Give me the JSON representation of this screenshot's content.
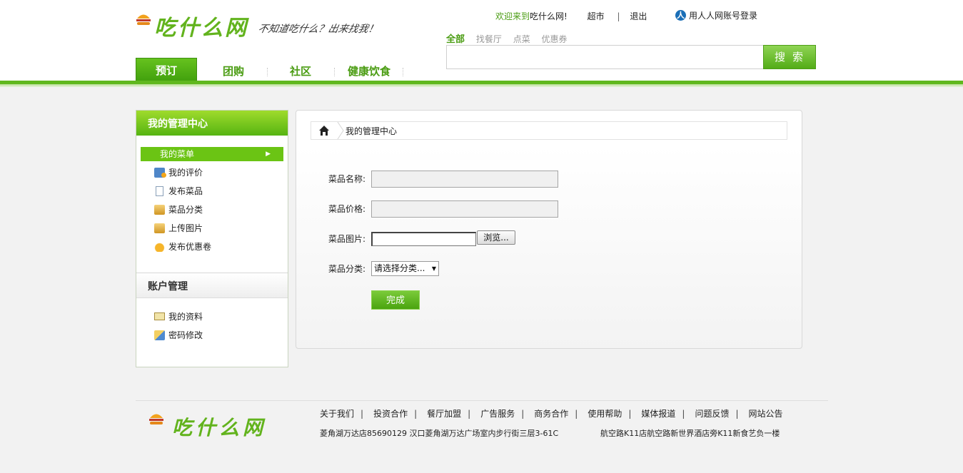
{
  "brand": {
    "name": "吃什么网",
    "slogan": "不知道吃什么？出来找我！"
  },
  "top_links": {
    "welcome": "欢迎来到",
    "site": "吃什么网!",
    "supermarket": "超市",
    "separator": "|",
    "logout": "退出",
    "renren_login": "用人人网账号登录"
  },
  "search": {
    "tabs": [
      "全部",
      "找餐厅",
      "点菜",
      "优惠券"
    ],
    "active_tab": "全部",
    "value": "",
    "button": "搜索"
  },
  "nav": {
    "items": [
      "预订",
      "团购",
      "社区",
      "健康饮食"
    ],
    "active": "预订"
  },
  "sidebar": {
    "title": "我的管理中心",
    "menu_title": "我的菜单",
    "menu_items": [
      {
        "label": "我的评价",
        "icon": "review-icon"
      },
      {
        "label": "发布菜品",
        "icon": "document-icon"
      },
      {
        "label": "菜品分类",
        "icon": "category-icon"
      },
      {
        "label": "上传图片",
        "icon": "upload-image-icon"
      },
      {
        "label": "发布优惠卷",
        "icon": "coupon-icon"
      }
    ],
    "account_title": "账户管理",
    "account_items": [
      {
        "label": "我的资料",
        "icon": "profile-card-icon"
      },
      {
        "label": "密码修改",
        "icon": "edit-password-icon"
      }
    ]
  },
  "breadcrumb": {
    "current": "我的管理中心"
  },
  "form": {
    "name_label": "菜品名称:",
    "name_value": "",
    "price_label": "菜品价格:",
    "price_value": "",
    "image_label": "菜品图片:",
    "browse_label": "浏览...",
    "category_label": "菜品分类:",
    "category_selected": "请选择分类...",
    "submit_label": "完成"
  },
  "footer": {
    "links": [
      "关于我们",
      "投资合作",
      "餐厅加盟",
      "广告服务",
      "商务合作",
      "使用帮助",
      "媒体报道",
      "问题反馈",
      "网站公告"
    ],
    "address1": "菱角湖万达店85690129 汉口菱角湖万达广场室内步行街三层3-61C",
    "address2": "航空路K11店航空路新世界酒店旁K11新食艺负一楼"
  },
  "colors": {
    "brand_green": "#62b31d",
    "nav_active": "#4aa40f",
    "link_green": "#4a9c12"
  }
}
